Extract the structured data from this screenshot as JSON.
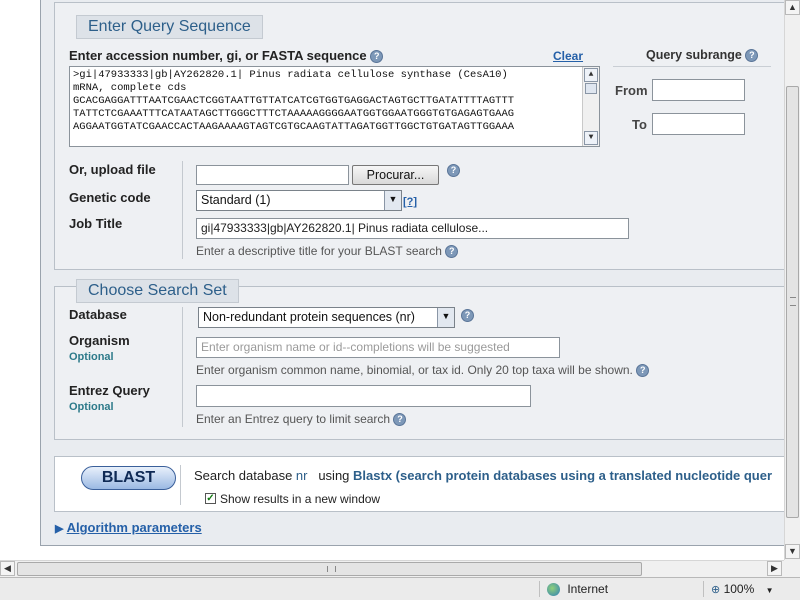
{
  "query": {
    "panel_title": "Enter Query Sequence",
    "input_label": "Enter accession number, gi, or FASTA sequence",
    "clear_label": "Clear",
    "sequence_lines": [
      ">gi|47933333|gb|AY262820.1| Pinus radiata cellulose synthase (CesA10)",
      "mRNA, complete cds",
      "GCACGAGGATTTAATCGAACTCGGTAATTGTTATCATCGTGGTGAGGACTAGTGCTTGATATTTTAGTTT",
      "TATTCTCGAAATTTCATAATAGCTTGGGCTTTCTAAAAAGGGGAATGGTGGAATGGGTGTGAGAGTGAAG",
      "AGGAATGGTATCGAACCACTAAGAAAAGTAGTCGTGCAAGTATTAGATGGTTGGCTGTGATAGTTGGAAA"
    ],
    "subrange_title": "Query subrange",
    "from_label": "From",
    "to_label": "To",
    "from_value": "",
    "to_value": "",
    "upload_label": "Or, upload file",
    "upload_button": "Procurar...",
    "genetic_code_label": "Genetic code",
    "genetic_code_value": "Standard (1)",
    "genetic_code_help": "[?]",
    "job_title_label": "Job Title",
    "job_title_value": "gi|47933333|gb|AY262820.1| Pinus radiata cellulose...",
    "job_title_help": "Enter a descriptive title for your BLAST search"
  },
  "search_set": {
    "panel_title": "Choose Search Set",
    "database_label": "Database",
    "database_value": "Non-redundant protein sequences (nr)",
    "organism_label": "Organism",
    "organism_optional": "Optional",
    "organism_placeholder": "Enter organism name or id--completions will be suggested",
    "organism_help": "Enter organism common name, binomial, or tax id. Only 20 top taxa will be shown.",
    "entrez_label": "Entrez Query",
    "entrez_optional": "Optional",
    "entrez_value": "",
    "entrez_help": "Enter an Entrez query to limit search"
  },
  "blast": {
    "button": "BLAST",
    "search_prefix": "Search database",
    "database_short": "nr",
    "using_text": "using",
    "program_text": "Blastx (search protein databases using a translated nucleotide quer",
    "new_window_label": "Show results in a new window",
    "new_window_checked": true
  },
  "algorithm": {
    "label": "Algorithm parameters"
  },
  "statusbar": {
    "zone": "Internet",
    "zoom": "100%"
  },
  "colors": {
    "title_text": "#2d5f8a",
    "link": "#2560a8",
    "optional": "#2d7a8a"
  },
  "icons": {
    "help": "help-circle-icon",
    "globe": "globe-icon",
    "zoom": "zoom-icon"
  }
}
